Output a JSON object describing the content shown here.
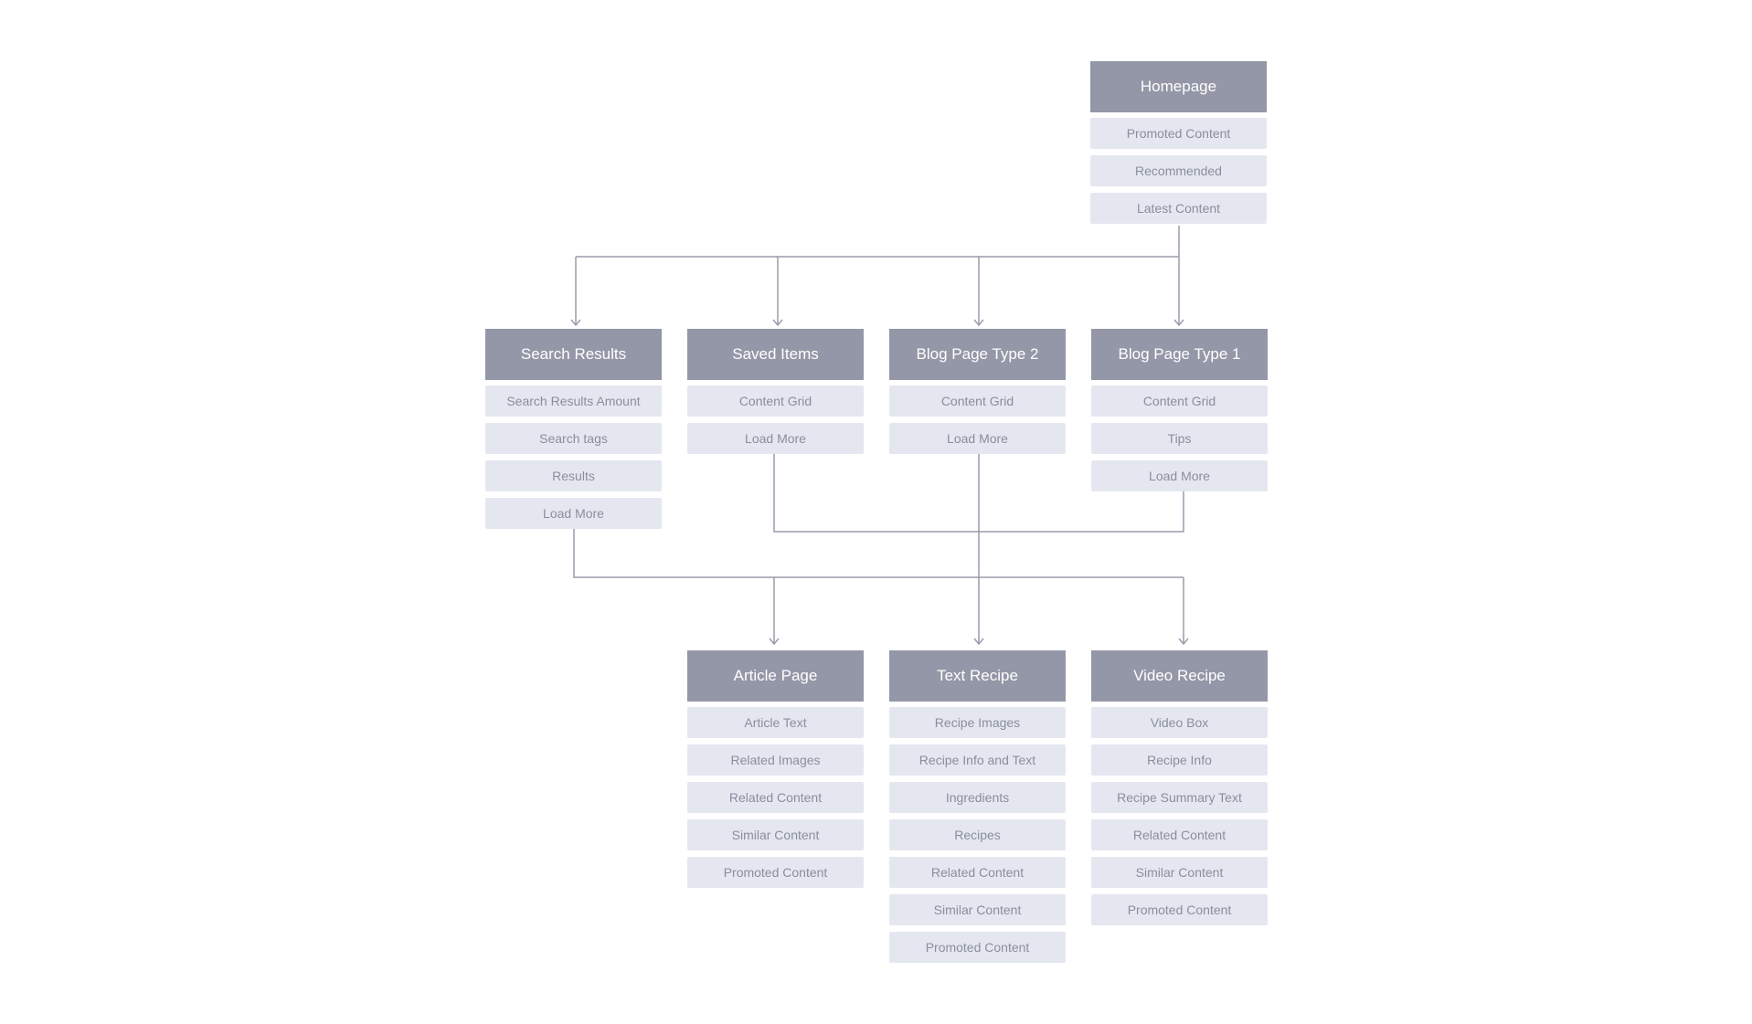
{
  "nodes": [
    {
      "id": "homepage",
      "title": "Homepage",
      "items": [
        "Promoted Content",
        "Recommended",
        "Latest Content"
      ]
    },
    {
      "id": "search-results",
      "title": "Search Results",
      "items": [
        "Search Results Amount",
        "Search tags",
        "Results",
        "Load More"
      ]
    },
    {
      "id": "saved-items",
      "title": "Saved Items",
      "items": [
        "Content Grid",
        "Load More"
      ]
    },
    {
      "id": "blog-page-type-2",
      "title": "Blog Page Type 2",
      "items": [
        "Content Grid",
        "Load More"
      ]
    },
    {
      "id": "blog-page-type-1",
      "title": "Blog Page Type 1",
      "items": [
        "Content Grid",
        "Tips",
        "Load More"
      ]
    },
    {
      "id": "article-page",
      "title": "Article Page",
      "items": [
        "Article Text",
        "Related Images",
        "Related Content",
        "Similar Content",
        "Promoted Content"
      ]
    },
    {
      "id": "text-recipe",
      "title": "Text Recipe",
      "items": [
        "Recipe Images",
        "Recipe Info and Text",
        "Ingredients",
        "Recipes",
        "Related Content",
        "Similar Content",
        "Promoted Content"
      ]
    },
    {
      "id": "video-recipe",
      "title": "Video Recipe",
      "items": [
        "Video Box",
        "Recipe Info",
        "Recipe Summary Text",
        "Related Content",
        "Similar Content",
        "Promoted Content"
      ]
    }
  ],
  "colors": {
    "header": "#9497a7",
    "item": "#e5e7f0",
    "item_text": "#8a8d9e",
    "connector": "#9a9cab"
  }
}
